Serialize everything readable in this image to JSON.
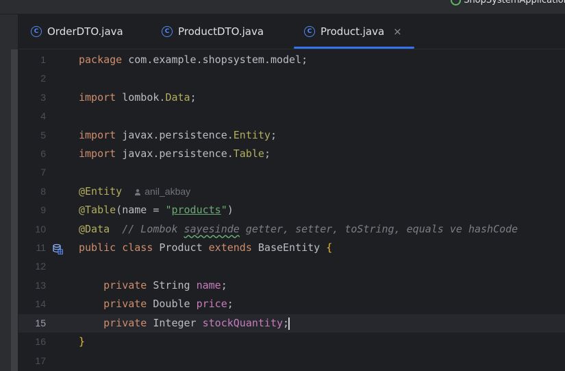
{
  "window": {
    "run_config_label": "ShopSystemApplication"
  },
  "tabs": [
    {
      "label": "OrderDTO.java",
      "icon": "class-icon",
      "active": false
    },
    {
      "label": "ProductDTO.java",
      "icon": "class-icon",
      "active": false
    },
    {
      "label": "Product.java",
      "icon": "class-icon",
      "active": true,
      "close": "×"
    }
  ],
  "editor": {
    "current_line": 15,
    "line_numbers": [
      "1",
      "2",
      "3",
      "4",
      "5",
      "6",
      "7",
      "8",
      "9",
      "10",
      "11",
      "12",
      "13",
      "14",
      "15",
      "16",
      "17"
    ],
    "author_hint": "anil_akbay",
    "colors": {
      "keyword": "#cf8e6d",
      "annotation": "#b3ae60",
      "string": "#6aab73",
      "field": "#c77dbb",
      "comment": "#7a7e85",
      "text": "#bcbec4",
      "accent": "#3574f0"
    },
    "code": {
      "l1_kw": "package",
      "l1_rest": " com.example.shopsystem.model;",
      "l3_kw": "import",
      "l3_pkg": " lombok.",
      "l3_cls": "Data",
      "l3_semi": ";",
      "l5_kw": "import",
      "l5_pkg": " javax.persistence.",
      "l5_cls": "Entity",
      "l5_semi": ";",
      "l6_kw": "import",
      "l6_pkg": " javax.persistence.",
      "l6_cls": "Table",
      "l6_semi": ";",
      "l8_ann": "@Entity",
      "l9_ann": "@Table",
      "l9_open": "(name = ",
      "l9_q1": "\"",
      "l9_str": "products",
      "l9_q2": "\"",
      "l9_close": ")",
      "l10_ann": "@Data",
      "l10_cmt1": "  // Lombok ",
      "l10_cmt_wavy": "sayesinde",
      "l10_cmt2": " getter, setter, toString, equals ve hashCode",
      "l11_kw1": "public",
      "l11_kw2": "class",
      "l11_name": " Product ",
      "l11_kw3": "extends",
      "l11_base": " BaseEntity ",
      "l11_brace": "{",
      "l13_kw": "private",
      "l13_type": " String ",
      "l13_field": "name",
      "l13_semi": ";",
      "l14_kw": "private",
      "l14_type": " Double ",
      "l14_field": "price",
      "l14_semi": ";",
      "l15_kw": "private",
      "l15_type": " Integer ",
      "l15_field": "stockQuantity",
      "l15_semi": ";",
      "l16_brace": "}"
    }
  }
}
